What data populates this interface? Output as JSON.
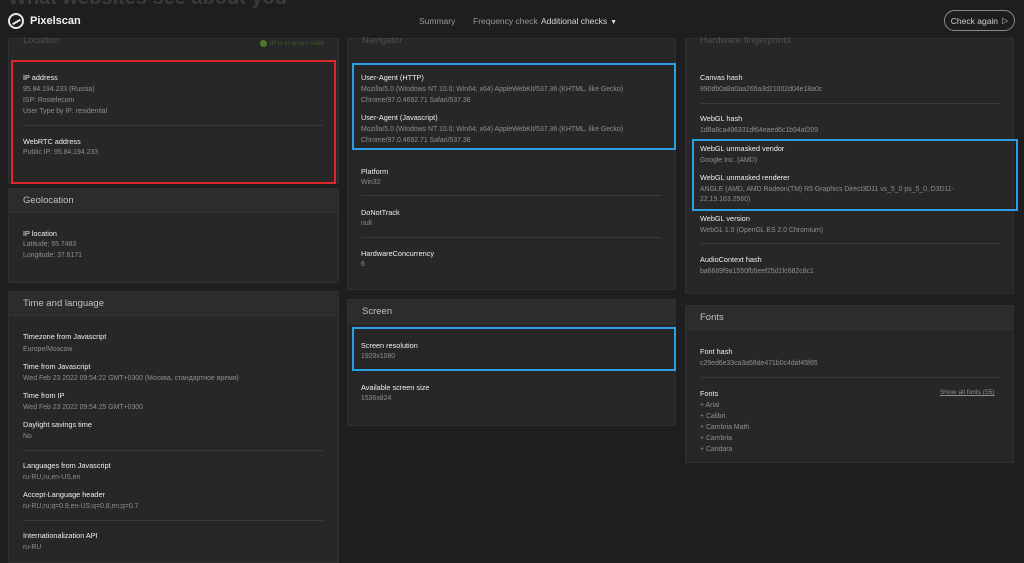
{
  "page": {
    "background_title": "What websites see about you"
  },
  "header": {
    "brand": "Pixelscan",
    "nav": [
      "Summary",
      "Frequency check",
      "Additional checks"
    ],
    "check_again": "Check again"
  },
  "left": {
    "location": {
      "title": "Location",
      "match_note": "IP is in green state",
      "ip_label": "IP address",
      "ip_value": "95.84.194.233 (Russia)",
      "isp": "ISP: Rostelecom",
      "user_type": "User Type by IP: residential",
      "webrtc_label": "WebRTC address",
      "webrtc_value": "Public IP: 95.84.194.233"
    },
    "geolocation": {
      "title": "Geolocation",
      "label": "IP location",
      "latitude": "Latitude: 55.7483",
      "longitude": "Longitude: 37.6171"
    },
    "time_language": {
      "title": "Time and language",
      "tz_label": "Timezone from Javascript",
      "tz_value": "Europe/Moscow",
      "time_js_label": "Time from Javascript",
      "time_js_value": "Wed Feb 23 2022 09:54:22 GMT+0300 (Москва, стандартное время)",
      "time_ip_label": "Time from IP",
      "time_ip_value": "Wed Feb 23 2022 09:54:25 GMT+0300",
      "dst_label": "Daylight savings time",
      "dst_value": "No",
      "lang_js_label": "Languages from Javascript",
      "lang_js_value": "ru-RU,ru,en-US,en",
      "accept_lang_label": "Accept-Language header",
      "accept_lang_value": "ru-RU,ru;q=0.9,en-US;q=0.8,en;q=0.7",
      "intl_label": "Internationalization API",
      "intl_value": "ru-RU"
    }
  },
  "middle": {
    "navigator": {
      "title": "Navigator",
      "ua_http_label": "User-Agent (HTTP)",
      "ua_http_line1": "Mozilla/5.0 (Windows NT 10.0; Win64; x64) AppleWebKit/537.36 (KHTML, like Gecko)",
      "ua_http_line2": "Chrome/97.0.4692.71 Safari/537.36",
      "ua_js_label": "User-Agent (Javascript)",
      "ua_js_line1": "Mozilla/5.0 (Windows NT 10.0; Win64; x64) AppleWebKit/537.36 (KHTML, like Gecko)",
      "ua_js_line2": "Chrome/97.0.4692.71 Safari/537.36",
      "platform_label": "Platform",
      "platform_value": "Win32",
      "dnt_label": "DoNotTrack",
      "dnt_value": "null",
      "hw_label": "HardwareConcurrency",
      "hw_value": "6"
    },
    "screen": {
      "title": "Screen",
      "res_label": "Screen resolution",
      "res_value": "1920x1080",
      "avail_label": "Available screen size",
      "avail_value": "1536x824"
    }
  },
  "right": {
    "hardware": {
      "title": "Hardware fingerprints",
      "canvas_label": "Canvas hash",
      "canvas_value": "990db0a8a0aa265a3d21002d04e18a0c",
      "webgl_label": "WebGL hash",
      "webgl_value": "1d8a8ca496331df64eaed6c1b94af209",
      "vendor_label": "WebGL unmasked vendor",
      "vendor_value": "Google Inc. (AMD)",
      "renderer_label": "WebGL unmasked renderer",
      "renderer_line1": "ANGLE (AMD, AMD Radeon(TM) R5 Graphics Direct3D11 vs_5_0 ps_5_0, D3D11-",
      "renderer_line2": "22.19.163.2560)",
      "version_label": "WebGL version",
      "version_value": "WebGL 1.0 (OpenGL ES 2.0 Chromium)",
      "audio_label": "AudioContext hash",
      "audio_value": "ba6689f9a1550fb5eef25d1fc682c8c1"
    },
    "fonts": {
      "title": "Fonts",
      "hash_label": "Font hash",
      "hash_value": "c29ed6e33ca3a58de471b0c4daf45f65",
      "list_label": "Fonts",
      "show_all": "Show all fonts (55)",
      "items": [
        "+ Arial",
        "+ Calibri",
        "+ Cambria Math",
        "+ Cambria",
        "+ Candara"
      ]
    }
  },
  "colors": {
    "highlight_red": "#e0252f",
    "highlight_blue": "#2a9fe3"
  }
}
